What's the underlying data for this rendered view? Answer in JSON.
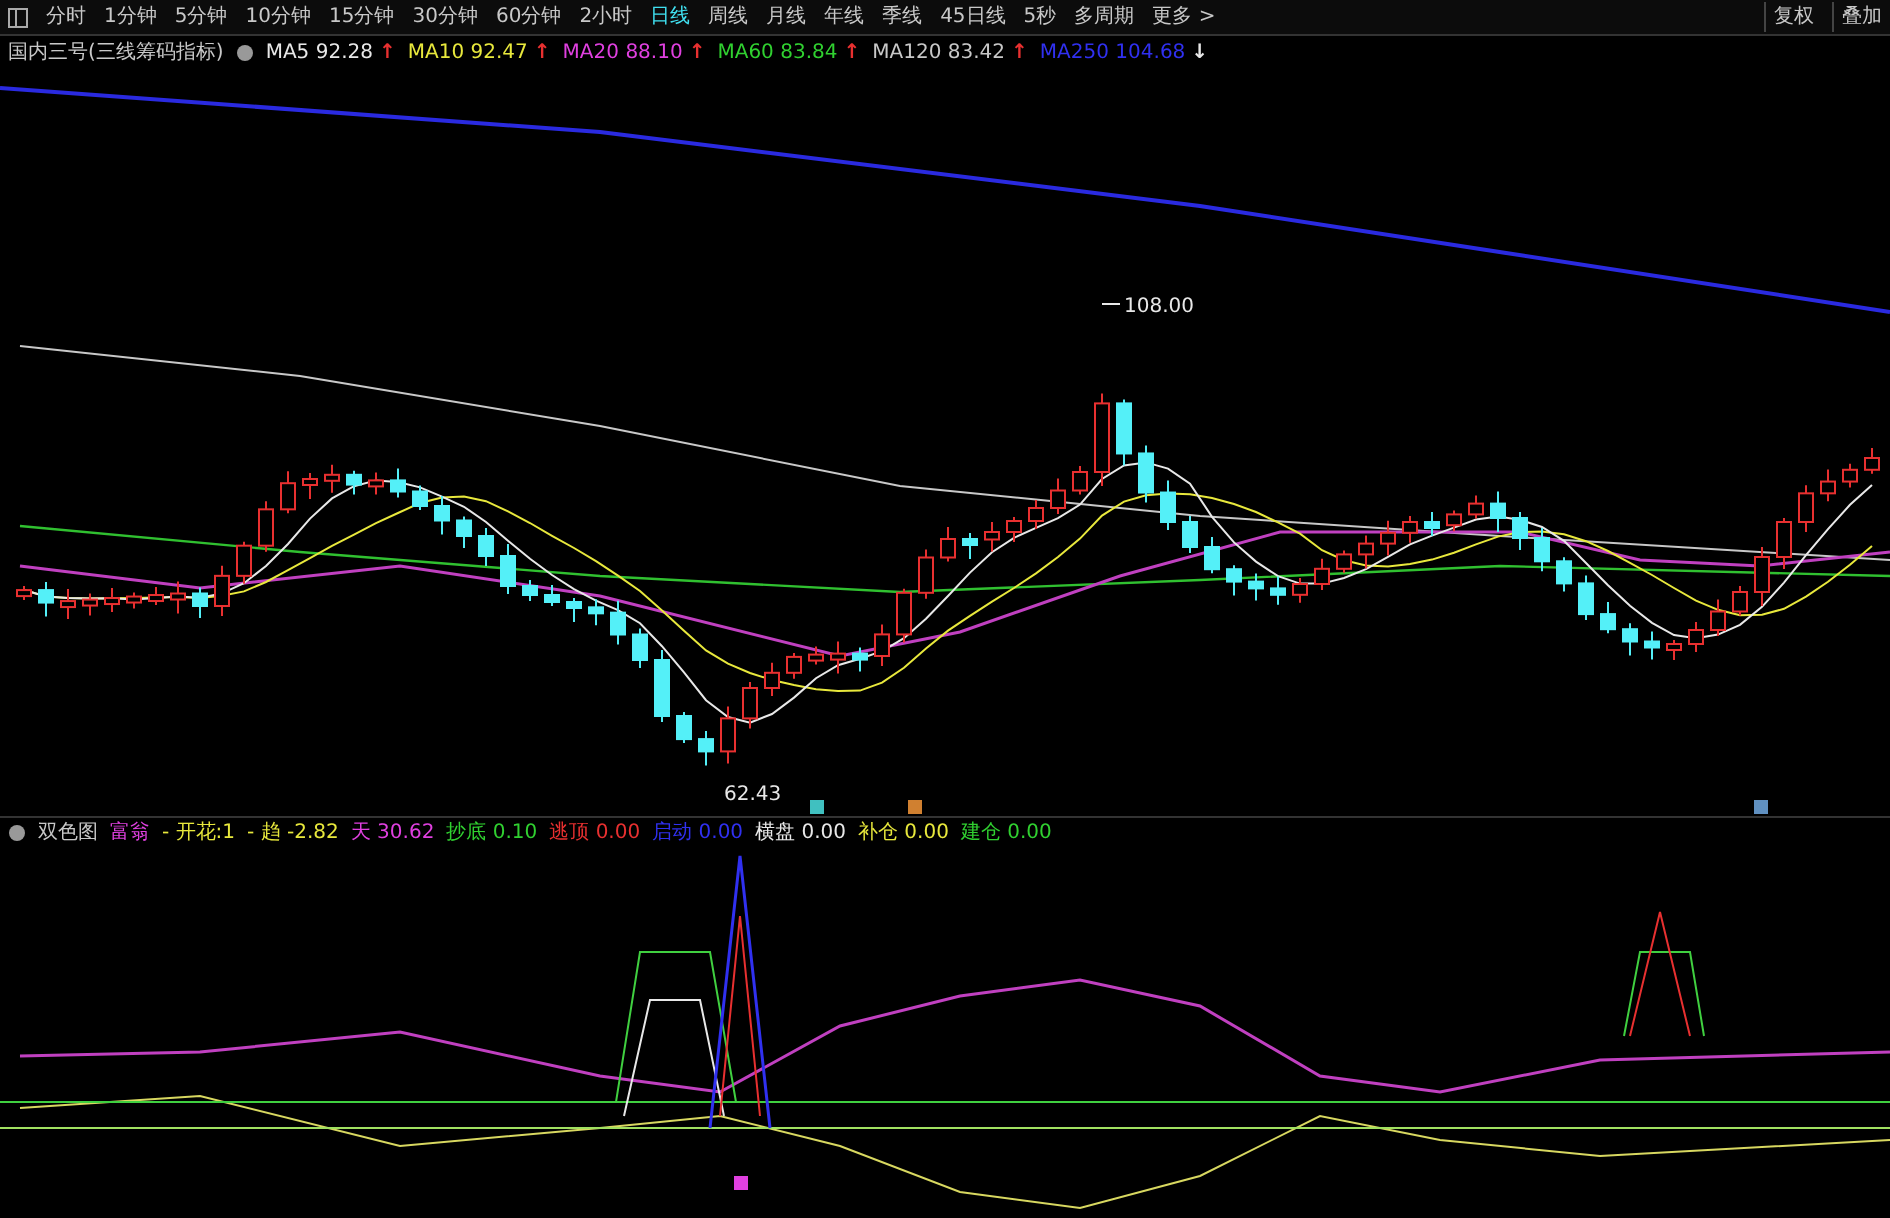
{
  "toolbar": {
    "periods": [
      {
        "label": "分时",
        "selected": false
      },
      {
        "label": "1分钟",
        "selected": false
      },
      {
        "label": "5分钟",
        "selected": false
      },
      {
        "label": "10分钟",
        "selected": false
      },
      {
        "label": "15分钟",
        "selected": false
      },
      {
        "label": "30分钟",
        "selected": false
      },
      {
        "label": "60分钟",
        "selected": false
      },
      {
        "label": "2小时",
        "selected": false
      },
      {
        "label": "日线",
        "selected": true
      },
      {
        "label": "周线",
        "selected": false
      },
      {
        "label": "月线",
        "selected": false
      },
      {
        "label": "年线",
        "selected": false
      },
      {
        "label": "季线",
        "selected": false
      },
      {
        "label": "45日线",
        "selected": false
      },
      {
        "label": "5秒",
        "selected": false
      },
      {
        "label": "多周期",
        "selected": false
      },
      {
        "label": "更多 >",
        "selected": false
      }
    ],
    "right_buttons": [
      "复权",
      "叠加"
    ]
  },
  "main_legend": {
    "title": "国内三号(三线筹码指标)",
    "items": [
      {
        "label": "MA5",
        "value": "92.28",
        "color": "#e8e8e8",
        "arrow": {
          "symbol": "↑",
          "color": "#e83030"
        }
      },
      {
        "label": "MA10",
        "value": "92.47",
        "color": "#e8e83c",
        "arrow": {
          "symbol": "↑",
          "color": "#e83030"
        }
      },
      {
        "label": "MA20",
        "value": "88.10",
        "color": "#e040e0",
        "arrow": {
          "symbol": "↑",
          "color": "#e83030"
        }
      },
      {
        "label": "MA60",
        "value": "83.84",
        "color": "#30d030",
        "arrow": {
          "symbol": "↑",
          "color": "#e83030"
        }
      },
      {
        "label": "MA120",
        "value": "83.42",
        "color": "#c8c8c8",
        "arrow": {
          "symbol": "↑",
          "color": "#e83030"
        }
      },
      {
        "label": "MA250",
        "value": "104.68",
        "color": "#3030f0",
        "arrow": {
          "symbol": "↓",
          "color": "#e8e8e8"
        }
      }
    ]
  },
  "main_chart": {
    "high_label": "108.00",
    "low_label": "62.43"
  },
  "indicator_legend": {
    "title": "双色图",
    "items": [
      {
        "label": "富翁",
        "color": "#e040e0"
      },
      {
        "label": "- 开花:1",
        "color": "#e8e83c"
      },
      {
        "label": "- 趋",
        "value": "-2.82",
        "color": "#e8e83c"
      },
      {
        "label": "天",
        "value": "30.62",
        "color": "#e040e0"
      },
      {
        "label": "抄底",
        "value": "0.10",
        "color": "#30d030"
      },
      {
        "label": "逃顶",
        "value": "0.00",
        "color": "#e83030"
      },
      {
        "label": "启动",
        "value": "0.00",
        "color": "#3030f0"
      },
      {
        "label": "横盘",
        "value": "0.00",
        "color": "#e8e8e8"
      },
      {
        "label": "补仓",
        "value": "0.00",
        "color": "#e8e83c"
      },
      {
        "label": "建仓",
        "value": "0.00",
        "color": "#30d030"
      }
    ]
  }
}
